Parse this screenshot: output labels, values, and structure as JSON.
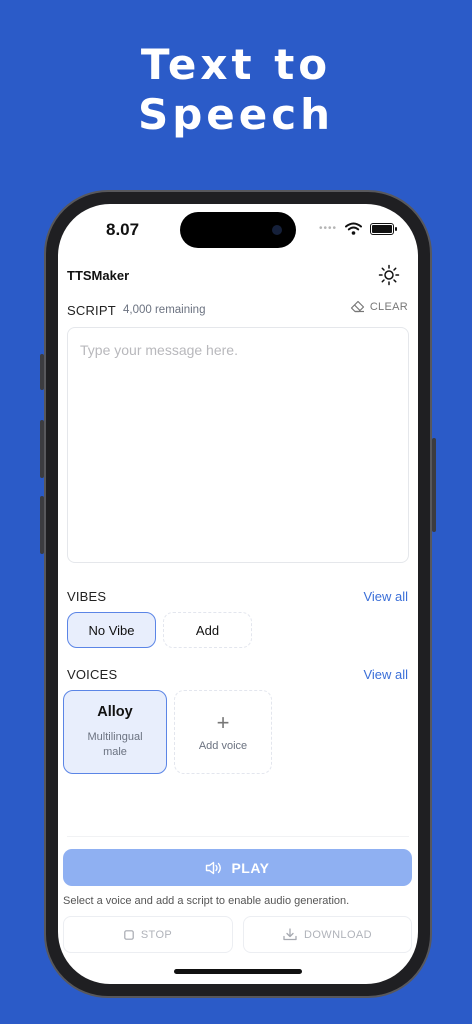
{
  "promo": {
    "title_line1": "Text to",
    "title_line2": "Speech"
  },
  "status_bar": {
    "time": "8.07",
    "signal_icon": "signal-dots-icon",
    "wifi_icon": "wifi-icon",
    "battery_icon": "battery-icon"
  },
  "header": {
    "app_name": "TTSMaker",
    "settings_icon": "sun-icon"
  },
  "script": {
    "label": "SCRIPT",
    "remaining": "4,000 remaining",
    "clear_label": "CLEAR",
    "clear_icon": "eraser-icon",
    "placeholder": "Type your message here.",
    "value": ""
  },
  "vibes": {
    "label": "VIBES",
    "view_all": "View all",
    "items": [
      {
        "label": "No Vibe",
        "selected": true
      },
      {
        "label": "Add",
        "selected": false
      }
    ]
  },
  "voices": {
    "label": "VOICES",
    "view_all": "View all",
    "selected_voice": {
      "name": "Alloy",
      "description": "Multilingual male"
    },
    "add_label": "Add voice"
  },
  "actions": {
    "play_label": "PLAY",
    "play_icon": "speaker-icon",
    "hint": "Select a voice and add a script to enable audio generation.",
    "stop_label": "STOP",
    "stop_icon": "stop-square-icon",
    "download_label": "DOWNLOAD",
    "download_icon": "download-icon"
  },
  "colors": {
    "background": "#2b5bc8",
    "accent": "#3b6fd8",
    "selected_fill": "#e8eefc",
    "selected_border": "#5b85e6",
    "play_disabled": "#8fb0f2"
  }
}
